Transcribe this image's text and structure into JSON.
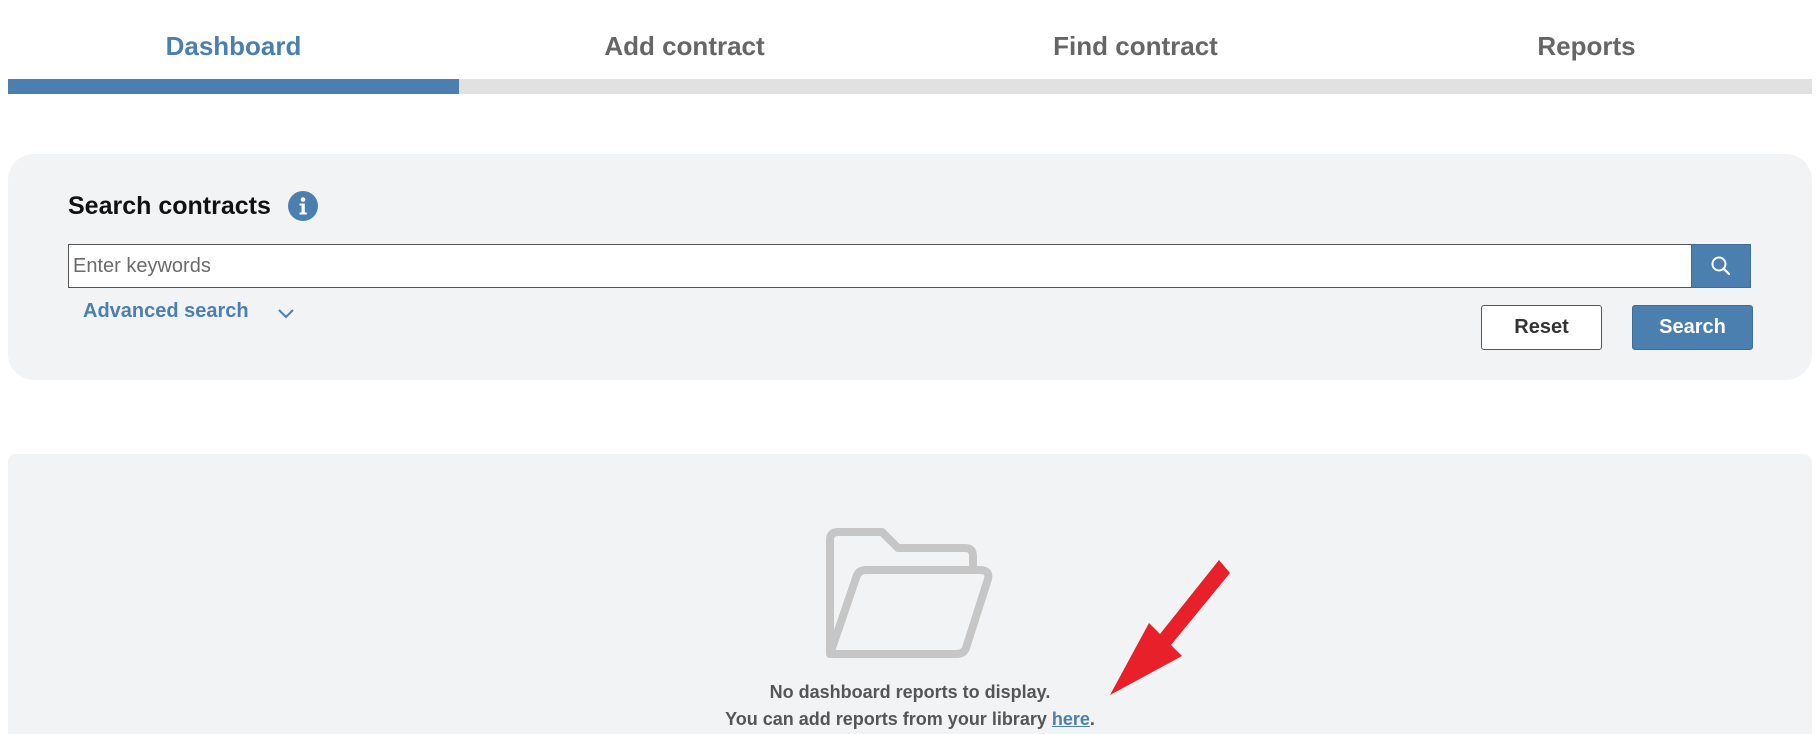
{
  "tabs": [
    {
      "label": "Dashboard",
      "active": true
    },
    {
      "label": "Add contract",
      "active": false
    },
    {
      "label": "Find contract",
      "active": false
    },
    {
      "label": "Reports",
      "active": false
    }
  ],
  "search": {
    "title": "Search contracts",
    "info_icon": "info-icon",
    "placeholder": "Enter keywords",
    "value": "",
    "search_icon": "search-icon",
    "advanced_label": "Advanced search",
    "advanced_icon": "chevron-down-icon",
    "reset_label": "Reset",
    "search_label": "Search"
  },
  "reports": {
    "empty_icon": "folder-open-icon",
    "empty_line1": "No dashboard reports to display.",
    "empty_line2_prefix": "You can add reports from your library ",
    "empty_link": "here",
    "empty_line2_suffix": "."
  },
  "colors": {
    "accent": "#4a7fb0",
    "tab_inactive_text": "#666666",
    "tab_bar_inactive": "#e1e1e1",
    "panel_bg": "#f2f3f4",
    "annotation": "#e8202a"
  }
}
